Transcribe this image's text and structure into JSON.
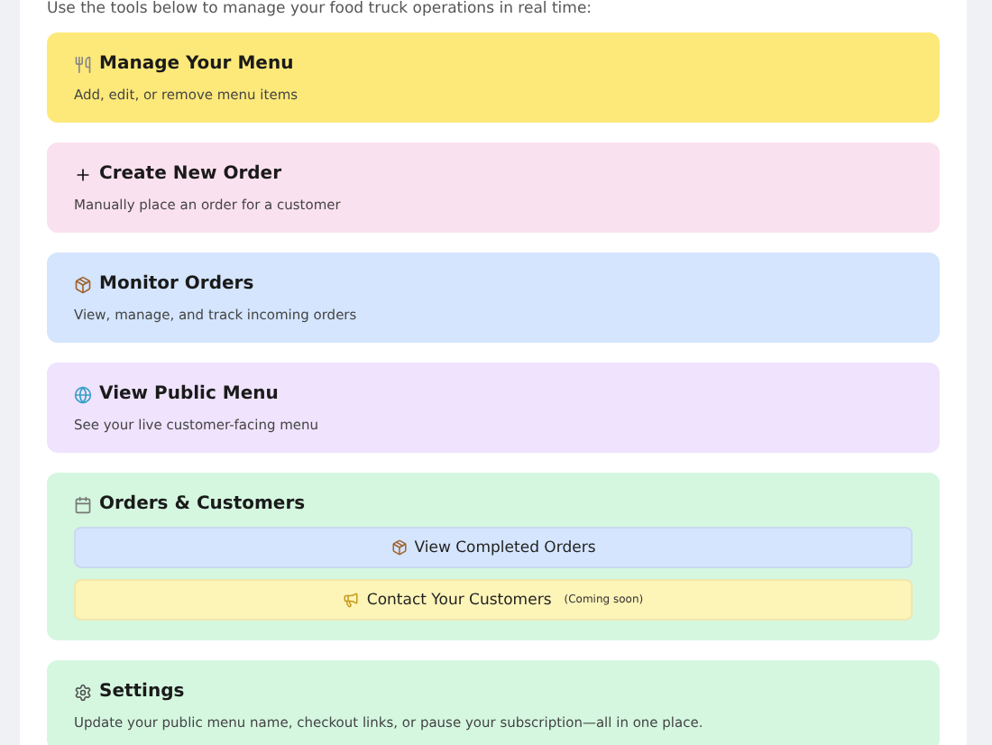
{
  "intro": "Use the tools below to manage your food truck operations in real time:",
  "cards": [
    {
      "kind": "link",
      "title": "Manage Your Menu",
      "description": "Add, edit, or remove menu items",
      "color": "#fde97a"
    },
    {
      "kind": "link",
      "title": "Create New Order",
      "description": "Manually place an order for a customer",
      "color": "#fae1ef"
    },
    {
      "kind": "link",
      "title": "Monitor Orders",
      "description": "View, manage, and track incoming orders",
      "color": "#d4e5fd"
    },
    {
      "kind": "link",
      "title": "View Public Menu",
      "description": "See your live customer-facing menu",
      "color": "#efe3fd"
    },
    {
      "kind": "group",
      "title": "Orders & Customers",
      "color": "#d5f7e0",
      "buttons": [
        {
          "label": "View Completed Orders",
          "color": "#d4e5fd"
        },
        {
          "label": "Contact Your Customers",
          "note": "(Coming soon)",
          "color": "#fdf4b8"
        }
      ]
    },
    {
      "kind": "link",
      "title": "Settings",
      "description": "Update your public menu name, checkout links, or pause your subscription—all in one place.",
      "color": "#d5f7e0"
    }
  ]
}
